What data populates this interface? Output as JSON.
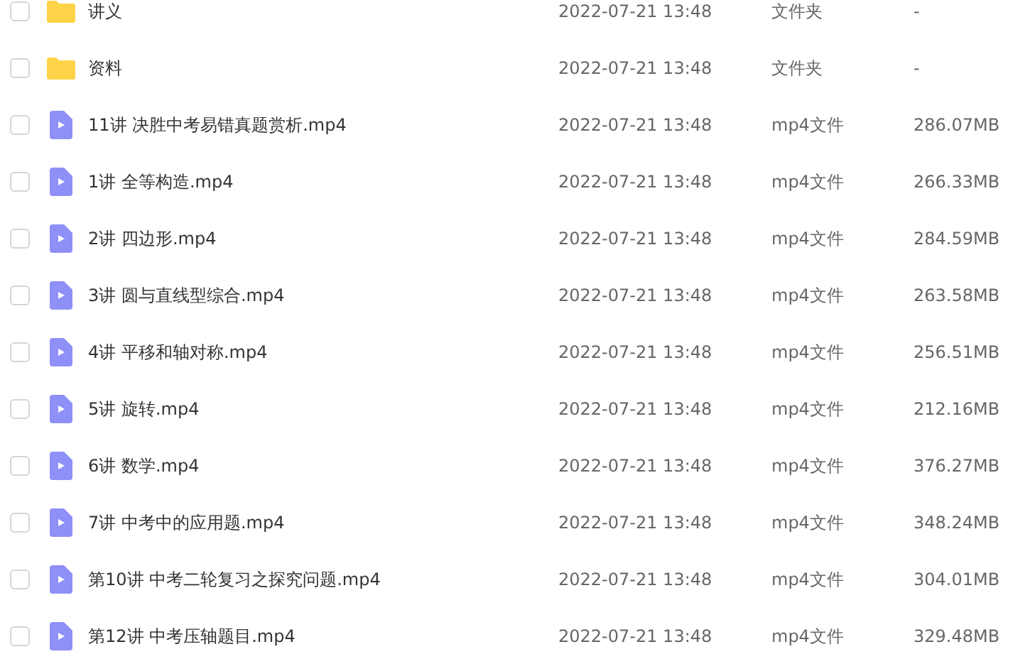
{
  "files": [
    {
      "kind": "folder",
      "checked": false,
      "name": "讲义",
      "modified": "2022-07-21 13:48",
      "type": "文件夹",
      "size": "-"
    },
    {
      "kind": "folder",
      "checked": false,
      "name": "资料",
      "modified": "2022-07-21 13:48",
      "type": "文件夹",
      "size": "-"
    },
    {
      "kind": "video",
      "checked": false,
      "name": "11讲 决胜中考易错真题赏析.mp4",
      "modified": "2022-07-21 13:48",
      "type": "mp4文件",
      "size": "286.07MB"
    },
    {
      "kind": "video",
      "checked": false,
      "name": "1讲 全等构造.mp4",
      "modified": "2022-07-21 13:48",
      "type": "mp4文件",
      "size": "266.33MB"
    },
    {
      "kind": "video",
      "checked": false,
      "name": "2讲 四边形.mp4",
      "modified": "2022-07-21 13:48",
      "type": "mp4文件",
      "size": "284.59MB"
    },
    {
      "kind": "video",
      "checked": false,
      "name": "3讲 圆与直线型综合.mp4",
      "modified": "2022-07-21 13:48",
      "type": "mp4文件",
      "size": "263.58MB"
    },
    {
      "kind": "video",
      "checked": false,
      "name": "4讲 平移和轴对称.mp4",
      "modified": "2022-07-21 13:48",
      "type": "mp4文件",
      "size": "256.51MB"
    },
    {
      "kind": "video",
      "checked": false,
      "name": "5讲 旋转.mp4",
      "modified": "2022-07-21 13:48",
      "type": "mp4文件",
      "size": "212.16MB"
    },
    {
      "kind": "video",
      "checked": false,
      "name": "6讲 数学.mp4",
      "modified": "2022-07-21 13:48",
      "type": "mp4文件",
      "size": "376.27MB"
    },
    {
      "kind": "video",
      "checked": false,
      "name": "7讲 中考中的应用题.mp4",
      "modified": "2022-07-21 13:48",
      "type": "mp4文件",
      "size": "348.24MB"
    },
    {
      "kind": "video",
      "checked": false,
      "name": "第10讲 中考二轮复习之探究问题.mp4",
      "modified": "2022-07-21 13:48",
      "type": "mp4文件",
      "size": "304.01MB"
    },
    {
      "kind": "video",
      "checked": false,
      "name": "第12讲 中考压轴题目.mp4",
      "modified": "2022-07-21 13:48",
      "type": "mp4文件",
      "size": "329.48MB"
    }
  ]
}
